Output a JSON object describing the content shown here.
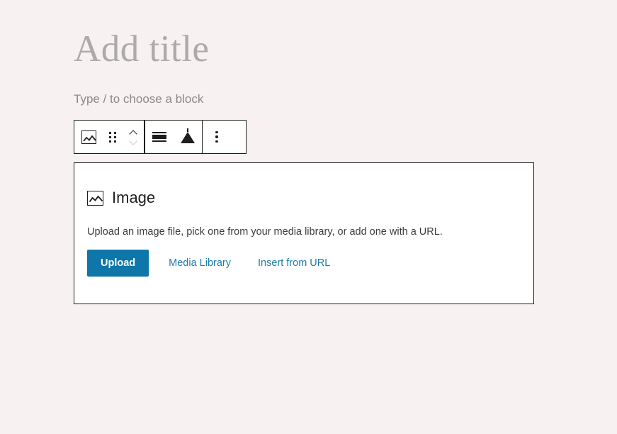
{
  "theme": {
    "canvas_background": "#f7f1f1",
    "block_border": "#1e1e1e",
    "accent_blue": "#0e76a8",
    "link_blue": "#1c7ba8",
    "placeholder_gray": "#8d8a8a",
    "title_gray": "#adaaaa",
    "card_background": "#ffffff"
  },
  "editor": {
    "title_placeholder": "Add title",
    "block_appender_placeholder": "Type / to choose a block"
  },
  "block_toolbar": {
    "items": [
      {
        "name": "block-type-image",
        "icon": "image-icon",
        "label": "Image"
      },
      {
        "name": "drag-handle",
        "icon": "drag-handle-icon",
        "label": "Drag"
      },
      {
        "name": "move-up",
        "icon": "chevron-up-icon",
        "label": "Move up",
        "enabled": true
      },
      {
        "name": "move-down",
        "icon": "chevron-down-icon",
        "label": "Move down",
        "enabled": false
      },
      {
        "name": "align",
        "icon": "align-bars-icon",
        "label": "Align"
      },
      {
        "name": "replace",
        "icon": "triangle-icon",
        "label": "Replace"
      },
      {
        "name": "more-options",
        "icon": "kebab-menu-icon",
        "label": "Options"
      }
    ]
  },
  "image_block": {
    "icon": "image-icon",
    "title": "Image",
    "description": "Upload an image file, pick one from your media library, or add one with a URL.",
    "actions": {
      "upload": "Upload",
      "media_library": "Media Library",
      "insert_from_url": "Insert from URL"
    }
  }
}
